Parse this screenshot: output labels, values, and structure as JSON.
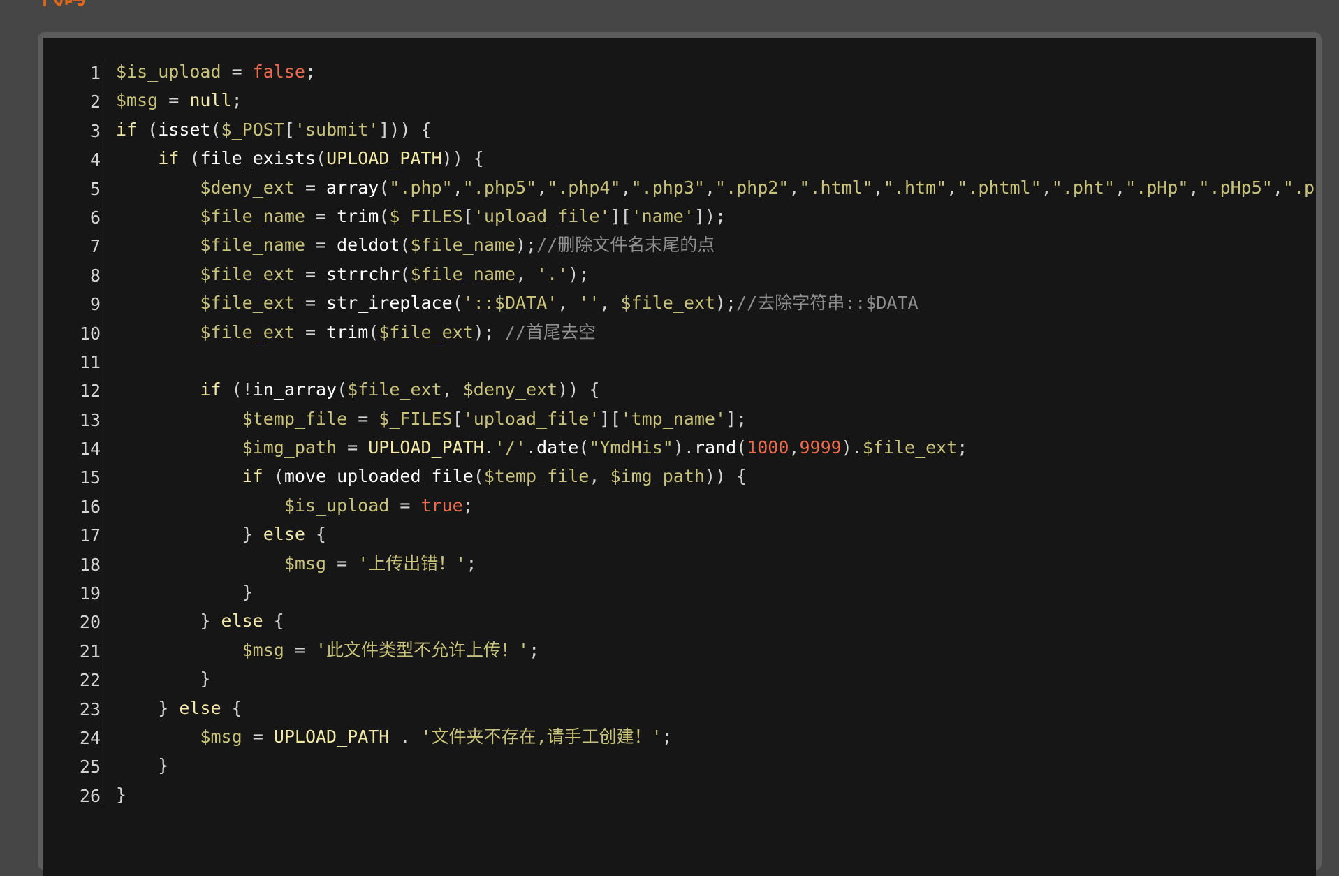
{
  "section": {
    "title": "代码"
  },
  "colors": {
    "page_bg": "#464646",
    "frame": "#5c5c5c",
    "code_bg": "#161616",
    "variable": "#c8c27a",
    "keyword": "#f2e8a6",
    "literal": "#ec6a4c",
    "comment": "#8f8f8f",
    "title": "#e0671a"
  },
  "code_lines": [
    {
      "n": "1",
      "tokens": [
        {
          "t": "var",
          "v": "$is_upload"
        },
        {
          "t": "op",
          "v": " = "
        },
        {
          "t": "lit",
          "v": "false"
        },
        {
          "t": "op",
          "v": ";"
        }
      ]
    },
    {
      "n": "2",
      "tokens": [
        {
          "t": "var",
          "v": "$msg"
        },
        {
          "t": "op",
          "v": " = "
        },
        {
          "t": "kw",
          "v": "null"
        },
        {
          "t": "op",
          "v": ";"
        }
      ]
    },
    {
      "n": "3",
      "tokens": [
        {
          "t": "kw",
          "v": "if"
        },
        {
          "t": "op",
          "v": " ("
        },
        {
          "t": "fn",
          "v": "isset"
        },
        {
          "t": "op",
          "v": "("
        },
        {
          "t": "var",
          "v": "$_POST"
        },
        {
          "t": "op",
          "v": "["
        },
        {
          "t": "str",
          "v": "'submit'"
        },
        {
          "t": "op",
          "v": "])) {"
        }
      ]
    },
    {
      "n": "4",
      "tokens": [
        {
          "t": "op",
          "v": "    "
        },
        {
          "t": "kw",
          "v": "if"
        },
        {
          "t": "op",
          "v": " ("
        },
        {
          "t": "fn",
          "v": "file_exists"
        },
        {
          "t": "op",
          "v": "("
        },
        {
          "t": "const",
          "v": "UPLOAD_PATH"
        },
        {
          "t": "op",
          "v": ")) {"
        }
      ]
    },
    {
      "n": "5",
      "tokens": [
        {
          "t": "op",
          "v": "        "
        },
        {
          "t": "var",
          "v": "$deny_ext"
        },
        {
          "t": "op",
          "v": " = "
        },
        {
          "t": "fn",
          "v": "array"
        },
        {
          "t": "op",
          "v": "("
        },
        {
          "t": "str",
          "v": "\".php\""
        },
        {
          "t": "op",
          "v": ","
        },
        {
          "t": "str",
          "v": "\".php5\""
        },
        {
          "t": "op",
          "v": ","
        },
        {
          "t": "str",
          "v": "\".php4\""
        },
        {
          "t": "op",
          "v": ","
        },
        {
          "t": "str",
          "v": "\".php3\""
        },
        {
          "t": "op",
          "v": ","
        },
        {
          "t": "str",
          "v": "\".php2\""
        },
        {
          "t": "op",
          "v": ","
        },
        {
          "t": "str",
          "v": "\".html\""
        },
        {
          "t": "op",
          "v": ","
        },
        {
          "t": "str",
          "v": "\".htm\""
        },
        {
          "t": "op",
          "v": ","
        },
        {
          "t": "str",
          "v": "\".phtml\""
        },
        {
          "t": "op",
          "v": ","
        },
        {
          "t": "str",
          "v": "\".pht\""
        },
        {
          "t": "op",
          "v": ","
        },
        {
          "t": "str",
          "v": "\".pHp\""
        },
        {
          "t": "op",
          "v": ","
        },
        {
          "t": "str",
          "v": "\".pHp5\""
        },
        {
          "t": "op",
          "v": ","
        },
        {
          "t": "str",
          "v": "\".p"
        }
      ]
    },
    {
      "n": "6",
      "tokens": [
        {
          "t": "op",
          "v": "        "
        },
        {
          "t": "var",
          "v": "$file_name"
        },
        {
          "t": "op",
          "v": " = "
        },
        {
          "t": "fn",
          "v": "trim"
        },
        {
          "t": "op",
          "v": "("
        },
        {
          "t": "var",
          "v": "$_FILES"
        },
        {
          "t": "op",
          "v": "["
        },
        {
          "t": "str",
          "v": "'upload_file'"
        },
        {
          "t": "op",
          "v": "]["
        },
        {
          "t": "str",
          "v": "'name'"
        },
        {
          "t": "op",
          "v": "]);"
        }
      ]
    },
    {
      "n": "7",
      "tokens": [
        {
          "t": "op",
          "v": "        "
        },
        {
          "t": "var",
          "v": "$file_name"
        },
        {
          "t": "op",
          "v": " = "
        },
        {
          "t": "fn",
          "v": "deldot"
        },
        {
          "t": "op",
          "v": "("
        },
        {
          "t": "var",
          "v": "$file_name"
        },
        {
          "t": "op",
          "v": ");"
        },
        {
          "t": "cmt",
          "v": "//删除文件名末尾的点"
        }
      ]
    },
    {
      "n": "8",
      "tokens": [
        {
          "t": "op",
          "v": "        "
        },
        {
          "t": "var",
          "v": "$file_ext"
        },
        {
          "t": "op",
          "v": " = "
        },
        {
          "t": "fn",
          "v": "strrchr"
        },
        {
          "t": "op",
          "v": "("
        },
        {
          "t": "var",
          "v": "$file_name"
        },
        {
          "t": "op",
          "v": ", "
        },
        {
          "t": "str",
          "v": "'.'"
        },
        {
          "t": "op",
          "v": ");"
        }
      ]
    },
    {
      "n": "9",
      "tokens": [
        {
          "t": "op",
          "v": "        "
        },
        {
          "t": "var",
          "v": "$file_ext"
        },
        {
          "t": "op",
          "v": " = "
        },
        {
          "t": "fn",
          "v": "str_ireplace"
        },
        {
          "t": "op",
          "v": "("
        },
        {
          "t": "str",
          "v": "'::$DATA'"
        },
        {
          "t": "op",
          "v": ", "
        },
        {
          "t": "str",
          "v": "''"
        },
        {
          "t": "op",
          "v": ", "
        },
        {
          "t": "var",
          "v": "$file_ext"
        },
        {
          "t": "op",
          "v": ");"
        },
        {
          "t": "cmt",
          "v": "//去除字符串::$DATA"
        }
      ]
    },
    {
      "n": "10",
      "tokens": [
        {
          "t": "op",
          "v": "        "
        },
        {
          "t": "var",
          "v": "$file_ext"
        },
        {
          "t": "op",
          "v": " = "
        },
        {
          "t": "fn",
          "v": "trim"
        },
        {
          "t": "op",
          "v": "("
        },
        {
          "t": "var",
          "v": "$file_ext"
        },
        {
          "t": "op",
          "v": "); "
        },
        {
          "t": "cmt",
          "v": "//首尾去空"
        }
      ]
    },
    {
      "n": "11",
      "tokens": []
    },
    {
      "n": "12",
      "tokens": [
        {
          "t": "op",
          "v": "        "
        },
        {
          "t": "kw",
          "v": "if"
        },
        {
          "t": "op",
          "v": " (!"
        },
        {
          "t": "fn",
          "v": "in_array"
        },
        {
          "t": "op",
          "v": "("
        },
        {
          "t": "var",
          "v": "$file_ext"
        },
        {
          "t": "op",
          "v": ", "
        },
        {
          "t": "var",
          "v": "$deny_ext"
        },
        {
          "t": "op",
          "v": ")) {"
        }
      ]
    },
    {
      "n": "13",
      "tokens": [
        {
          "t": "op",
          "v": "            "
        },
        {
          "t": "var",
          "v": "$temp_file"
        },
        {
          "t": "op",
          "v": " = "
        },
        {
          "t": "var",
          "v": "$_FILES"
        },
        {
          "t": "op",
          "v": "["
        },
        {
          "t": "str",
          "v": "'upload_file'"
        },
        {
          "t": "op",
          "v": "]["
        },
        {
          "t": "str",
          "v": "'tmp_name'"
        },
        {
          "t": "op",
          "v": "];"
        }
      ]
    },
    {
      "n": "14",
      "tokens": [
        {
          "t": "op",
          "v": "            "
        },
        {
          "t": "var",
          "v": "$img_path"
        },
        {
          "t": "op",
          "v": " = "
        },
        {
          "t": "const",
          "v": "UPLOAD_PATH"
        },
        {
          "t": "op",
          "v": "."
        },
        {
          "t": "str",
          "v": "'/'"
        },
        {
          "t": "op",
          "v": "."
        },
        {
          "t": "fn",
          "v": "date"
        },
        {
          "t": "op",
          "v": "("
        },
        {
          "t": "str",
          "v": "\"YmdHis\""
        },
        {
          "t": "op",
          "v": ")."
        },
        {
          "t": "fn",
          "v": "rand"
        },
        {
          "t": "op",
          "v": "("
        },
        {
          "t": "num",
          "v": "1000"
        },
        {
          "t": "op",
          "v": ","
        },
        {
          "t": "num",
          "v": "9999"
        },
        {
          "t": "op",
          "v": ")."
        },
        {
          "t": "var",
          "v": "$file_ext"
        },
        {
          "t": "op",
          "v": ";"
        }
      ]
    },
    {
      "n": "15",
      "tokens": [
        {
          "t": "op",
          "v": "            "
        },
        {
          "t": "kw",
          "v": "if"
        },
        {
          "t": "op",
          "v": " ("
        },
        {
          "t": "fn",
          "v": "move_uploaded_file"
        },
        {
          "t": "op",
          "v": "("
        },
        {
          "t": "var",
          "v": "$temp_file"
        },
        {
          "t": "op",
          "v": ", "
        },
        {
          "t": "var",
          "v": "$img_path"
        },
        {
          "t": "op",
          "v": ")) {"
        }
      ]
    },
    {
      "n": "16",
      "tokens": [
        {
          "t": "op",
          "v": "                "
        },
        {
          "t": "var",
          "v": "$is_upload"
        },
        {
          "t": "op",
          "v": " = "
        },
        {
          "t": "lit",
          "v": "true"
        },
        {
          "t": "op",
          "v": ";"
        }
      ]
    },
    {
      "n": "17",
      "tokens": [
        {
          "t": "op",
          "v": "            } "
        },
        {
          "t": "kw",
          "v": "else"
        },
        {
          "t": "op",
          "v": " {"
        }
      ]
    },
    {
      "n": "18",
      "tokens": [
        {
          "t": "op",
          "v": "                "
        },
        {
          "t": "var",
          "v": "$msg"
        },
        {
          "t": "op",
          "v": " = "
        },
        {
          "t": "str",
          "v": "'上传出错！'"
        },
        {
          "t": "op",
          "v": ";"
        }
      ]
    },
    {
      "n": "19",
      "tokens": [
        {
          "t": "op",
          "v": "            }"
        }
      ]
    },
    {
      "n": "20",
      "tokens": [
        {
          "t": "op",
          "v": "        } "
        },
        {
          "t": "kw",
          "v": "else"
        },
        {
          "t": "op",
          "v": " {"
        }
      ]
    },
    {
      "n": "21",
      "tokens": [
        {
          "t": "op",
          "v": "            "
        },
        {
          "t": "var",
          "v": "$msg"
        },
        {
          "t": "op",
          "v": " = "
        },
        {
          "t": "str",
          "v": "'此文件类型不允许上传！'"
        },
        {
          "t": "op",
          "v": ";"
        }
      ]
    },
    {
      "n": "22",
      "tokens": [
        {
          "t": "op",
          "v": "        }"
        }
      ]
    },
    {
      "n": "23",
      "tokens": [
        {
          "t": "op",
          "v": "    } "
        },
        {
          "t": "kw",
          "v": "else"
        },
        {
          "t": "op",
          "v": " {"
        }
      ]
    },
    {
      "n": "24",
      "tokens": [
        {
          "t": "op",
          "v": "        "
        },
        {
          "t": "var",
          "v": "$msg"
        },
        {
          "t": "op",
          "v": " = "
        },
        {
          "t": "const",
          "v": "UPLOAD_PATH"
        },
        {
          "t": "op",
          "v": " . "
        },
        {
          "t": "str",
          "v": "'文件夹不存在,请手工创建！'"
        },
        {
          "t": "op",
          "v": ";"
        }
      ]
    },
    {
      "n": "25",
      "tokens": [
        {
          "t": "op",
          "v": "    }"
        }
      ]
    },
    {
      "n": "26",
      "tokens": [
        {
          "t": "op",
          "v": "}"
        }
      ]
    }
  ]
}
